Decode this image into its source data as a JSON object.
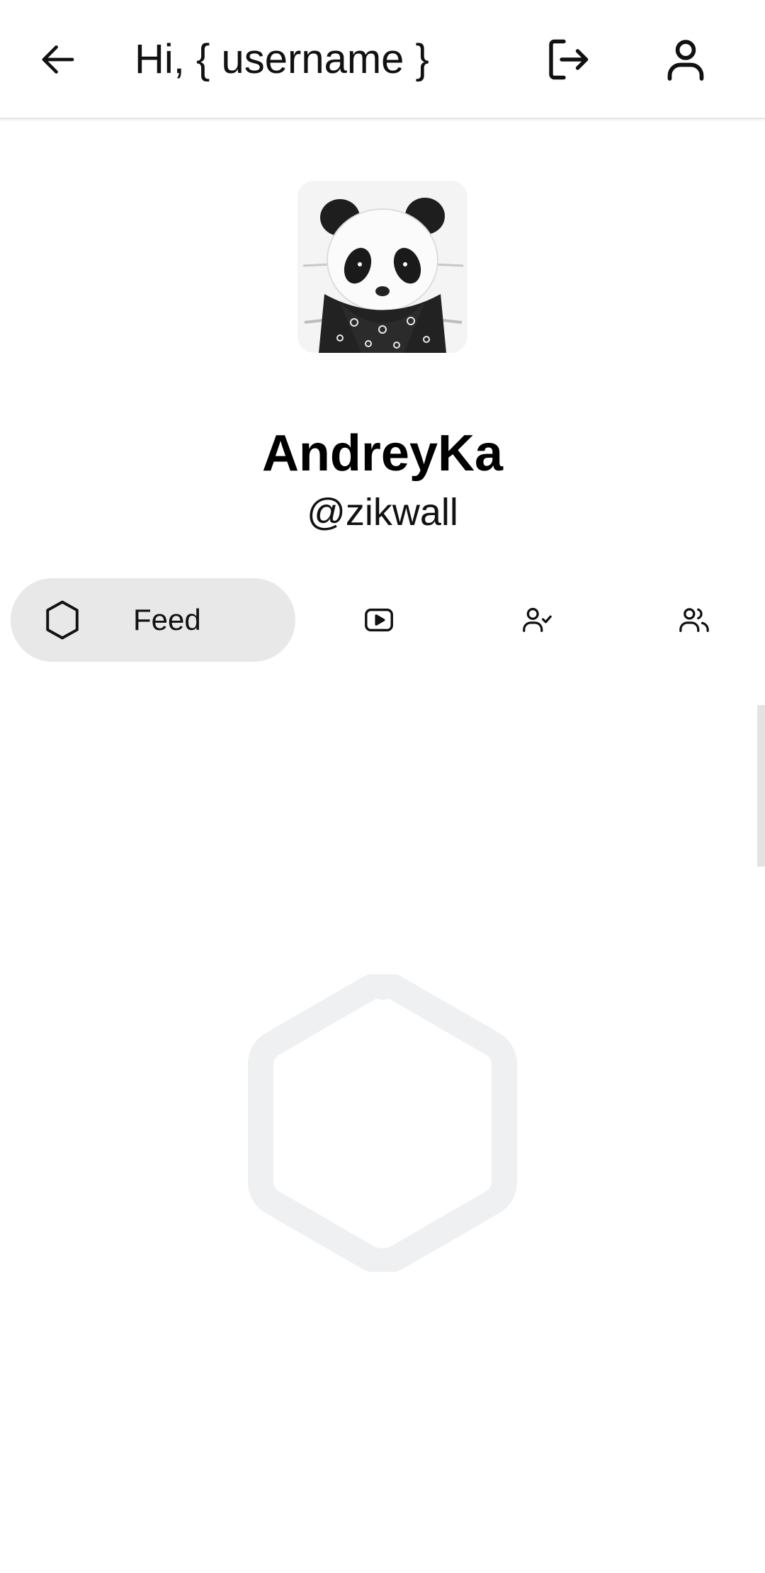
{
  "header": {
    "title": "Hi, { username }",
    "back_icon": "arrow-left-icon",
    "logout_icon": "logout-icon",
    "profile_icon": "user-icon"
  },
  "profile": {
    "avatar_description_icon": "panda-avatar",
    "display_name": "AndreyKa",
    "handle": "@zikwall"
  },
  "tabs": [
    {
      "label": "Feed",
      "icon": "hexagon-icon",
      "active": true
    },
    {
      "label": "",
      "icon": "video-play-icon",
      "active": false
    },
    {
      "label": "",
      "icon": "user-check-icon",
      "active": false
    },
    {
      "label": "",
      "icon": "users-icon",
      "active": false
    }
  ],
  "colors": {
    "active_tab_bg": "#e8e8e8",
    "empty_state_hex": "#eef0f2",
    "text": "#111111"
  },
  "empty_state": {
    "icon": "hexagon-placeholder-icon"
  }
}
